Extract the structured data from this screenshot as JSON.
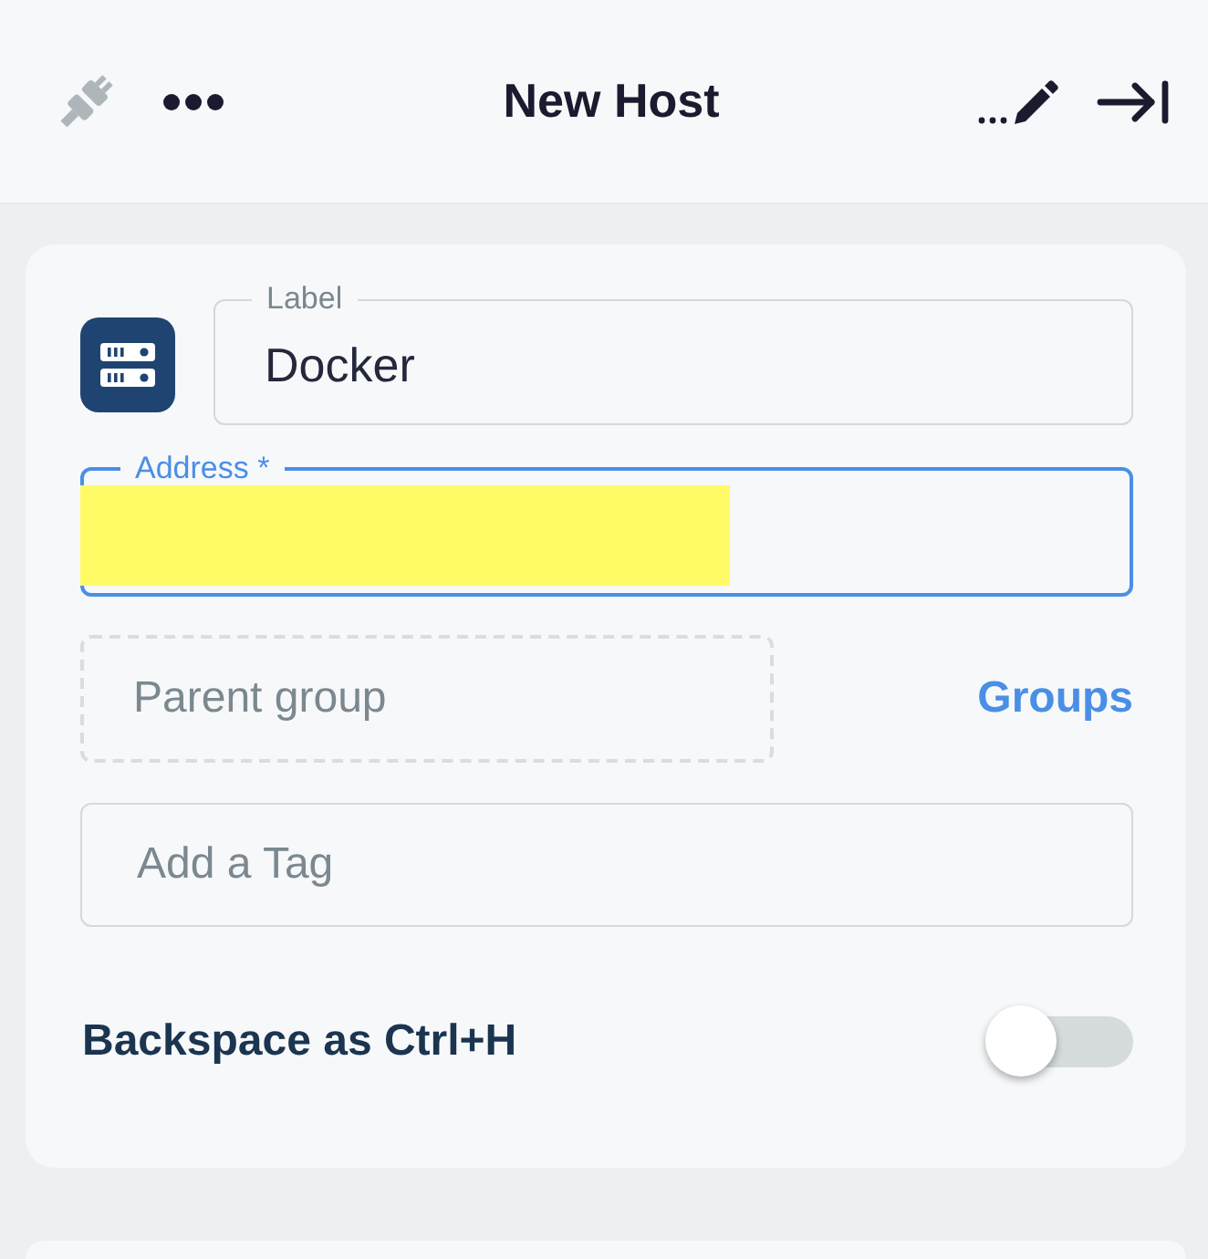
{
  "header": {
    "title": "New Host"
  },
  "label_field": {
    "label": "Label",
    "value": "Docker"
  },
  "address_field": {
    "label": "Address *",
    "focused": true,
    "redacted": true
  },
  "parent_group": {
    "placeholder": "Parent group"
  },
  "groups_link": "Groups",
  "tag_field": {
    "placeholder": "Add a Tag"
  },
  "backspace_toggle": {
    "label": "Backspace as Ctrl+H",
    "on": false
  }
}
